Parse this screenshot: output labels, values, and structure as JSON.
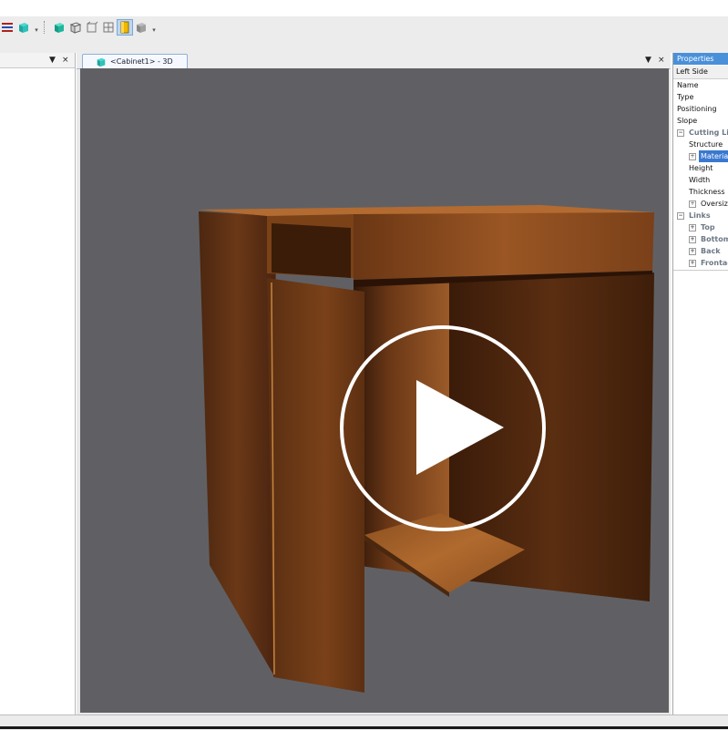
{
  "toolbar": {
    "icons": [
      "list-icon",
      "cube-icon",
      "more-icon",
      "cube-solid-icon",
      "cube-wire-icon",
      "front-view-icon",
      "side-view-icon",
      "material-icon",
      "render-icon",
      "more-icon"
    ]
  },
  "left_panel": {
    "pin_label": "▼",
    "close_label": "×"
  },
  "document": {
    "tab_label": "<Cabinet1> - 3D",
    "pin_label": "▼",
    "close_label": "×"
  },
  "properties": {
    "title": "Properties",
    "object": "Left Side",
    "rows": [
      {
        "label": "Name",
        "kind": "prop"
      },
      {
        "label": "Type",
        "kind": "prop"
      },
      {
        "label": "Positioning",
        "kind": "prop"
      },
      {
        "label": "Slope",
        "kind": "prop"
      },
      {
        "label": "Cutting Lis",
        "kind": "cat"
      },
      {
        "label": "Structure",
        "kind": "prop"
      },
      {
        "label": "Materia",
        "kind": "sel"
      },
      {
        "label": "Height",
        "kind": "prop"
      },
      {
        "label": "Width",
        "kind": "prop"
      },
      {
        "label": "Thickness",
        "kind": "prop"
      },
      {
        "label": "Oversizi",
        "kind": "prop"
      },
      {
        "label": "Links",
        "kind": "cat"
      },
      {
        "label": "Top",
        "kind": "cat"
      },
      {
        "label": "Bottom",
        "kind": "cat"
      },
      {
        "label": "Back",
        "kind": "cat"
      },
      {
        "label": "Frontag",
        "kind": "cat"
      }
    ]
  },
  "colors": {
    "viewport_bg": "#606064",
    "wood_dark": "#4a2610",
    "wood_mid": "#7a4219",
    "wood_light": "#a55f28",
    "selection": "#3a78d0",
    "props_title": "#4a90d9"
  }
}
